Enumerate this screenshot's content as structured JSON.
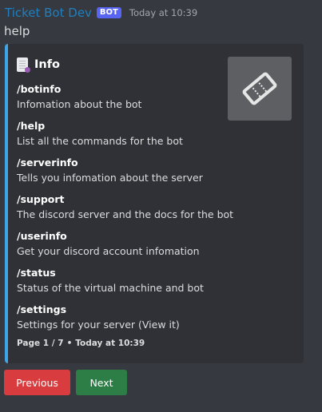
{
  "message": {
    "author": "Ticket Bot Dev",
    "bot_tag": "BOT",
    "timestamp": "Today at 10:39",
    "content": "help"
  },
  "embed": {
    "accent_color": "#3ea6e8",
    "title_icon": "page-facing-up-icon",
    "title": "Info",
    "thumbnail_icon": "ticket-icon",
    "fields": [
      {
        "name": "/botinfo",
        "value": "Infomation about the bot"
      },
      {
        "name": "/help",
        "value": "List all the commands for the bot"
      },
      {
        "name": "/serverinfo",
        "value": "Tells you infomation about the server"
      },
      {
        "name": "/support",
        "value": "The discord server and the docs for the bot"
      },
      {
        "name": "/userinfo",
        "value": "Get your discord account infomation"
      },
      {
        "name": "/status",
        "value": "Status of the virtual machine and bot"
      },
      {
        "name": "/settings",
        "value": "Settings for your server (View it)"
      }
    ],
    "footer": {
      "page": "Page 1 / 7",
      "separator": "•",
      "timestamp": "Today at 10:39"
    }
  },
  "buttons": {
    "previous": {
      "label": "Previous",
      "color": "#d83c3e"
    },
    "next": {
      "label": "Next",
      "color": "#2d7d46"
    }
  }
}
